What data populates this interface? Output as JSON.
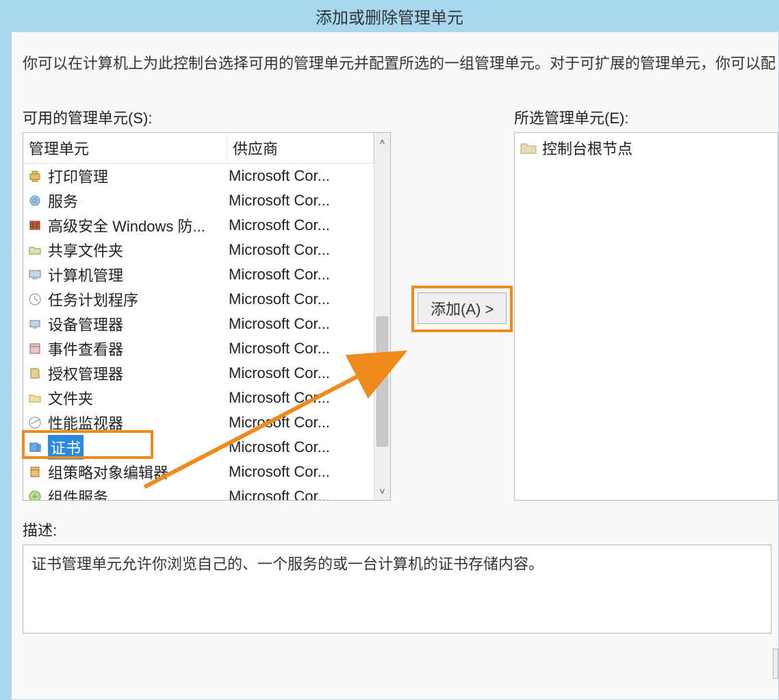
{
  "window": {
    "title": "添加或删除管理单元"
  },
  "instructions": "你可以在计算机上为此控制台选择可用的管理单元并配置所选的一组管理单元。对于可扩展的管理单元，你可以配",
  "available": {
    "label": "可用的管理单元(S):",
    "columns": {
      "name": "管理单元",
      "vendor": "供应商"
    },
    "items": [
      {
        "name": "打印管理",
        "vendor": "Microsoft Cor...",
        "icon": "printer-icon"
      },
      {
        "name": "服务",
        "vendor": "Microsoft Cor...",
        "icon": "gear-icon"
      },
      {
        "name": "高级安全 Windows 防...",
        "vendor": "Microsoft Cor...",
        "icon": "firewall-icon"
      },
      {
        "name": "共享文件夹",
        "vendor": "Microsoft Cor...",
        "icon": "shared-folder-icon"
      },
      {
        "name": "计算机管理",
        "vendor": "Microsoft Cor...",
        "icon": "computer-mgmt-icon"
      },
      {
        "name": "任务计划程序",
        "vendor": "Microsoft Cor...",
        "icon": "clock-icon"
      },
      {
        "name": "设备管理器",
        "vendor": "Microsoft Cor...",
        "icon": "device-mgr-icon"
      },
      {
        "name": "事件查看器",
        "vendor": "Microsoft Cor...",
        "icon": "event-viewer-icon"
      },
      {
        "name": "授权管理器",
        "vendor": "Microsoft Cor...",
        "icon": "auth-mgr-icon"
      },
      {
        "name": "文件夹",
        "vendor": "Microsoft Cor...",
        "icon": "folder-icon"
      },
      {
        "name": "性能监视器",
        "vendor": "Microsoft Cor...",
        "icon": "perfmon-icon"
      },
      {
        "name": "证书",
        "vendor": "Microsoft Cor...",
        "icon": "certificate-icon",
        "selected": true
      },
      {
        "name": "组策略对象编辑器",
        "vendor": "Microsoft Cor...",
        "icon": "gpo-icon"
      },
      {
        "name": "组件服务",
        "vendor": "Microsoft Cor...",
        "icon": "component-svc-icon"
      }
    ]
  },
  "buttons": {
    "add": "添加(A) >"
  },
  "selected": {
    "label": "所选管理单元(E):",
    "root": "控制台根节点"
  },
  "description": {
    "label": "描述:",
    "text": "证书管理单元允许你浏览自己的、一个服务的或一台计算机的证书存储内容。"
  }
}
